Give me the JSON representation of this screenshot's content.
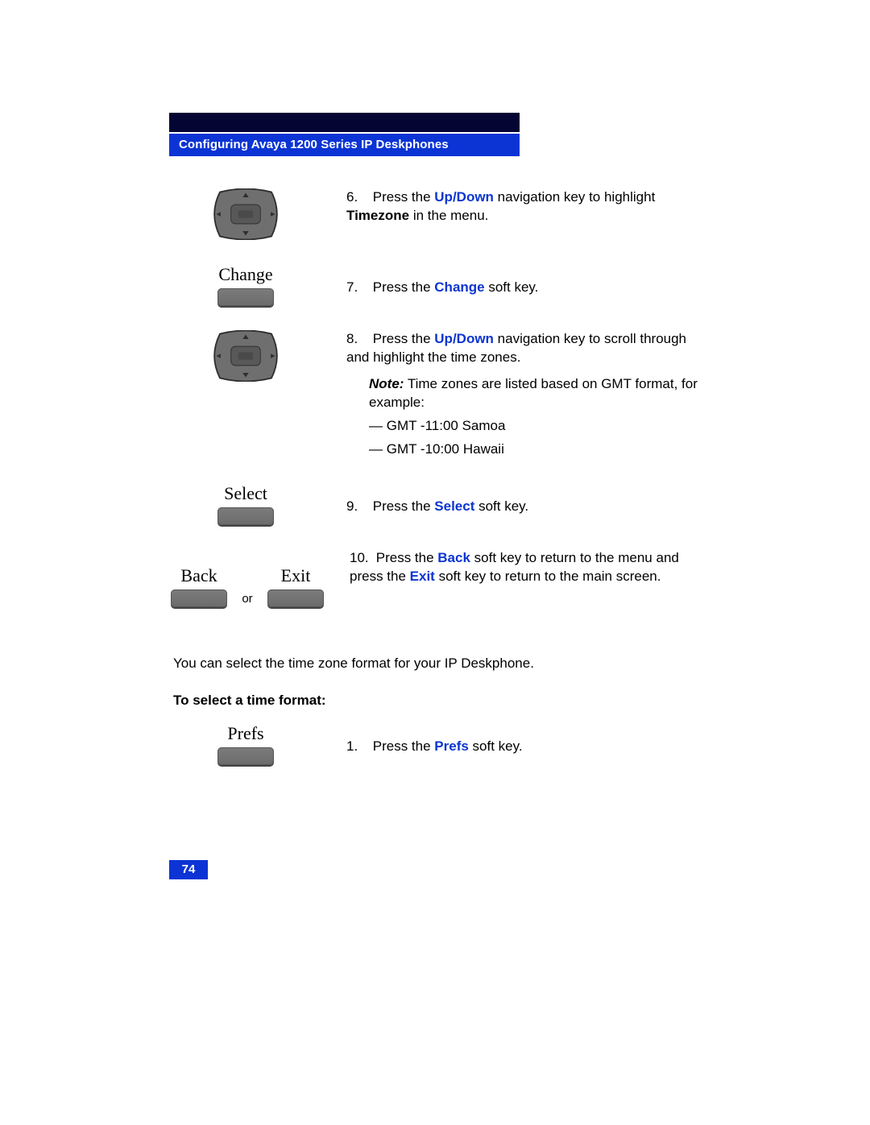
{
  "header": {
    "title": "Configuring Avaya 1200 Series IP Deskphones"
  },
  "page_number": "74",
  "steps": {
    "s6": {
      "num": "6.",
      "pre": "Press the ",
      "kw1": "Up/Down",
      "mid": " navigation key to highlight ",
      "kw2": "Timezone",
      "post": " in the menu."
    },
    "s7": {
      "softkey_label": "Change",
      "num": "7.",
      "pre": "Press the ",
      "kw": "Change",
      "post": " soft key."
    },
    "s8": {
      "num": "8.",
      "pre": "Press the ",
      "kw": "Up/Down",
      "post": " navigation key to scroll through and highlight the time zones.",
      "note_label": "Note:",
      "note_text": "  Time zones are listed based on GMT format, for example:",
      "dash1": "GMT -11:00 Samoa",
      "dash2": "GMT -10:00 Hawaii"
    },
    "s9": {
      "softkey_label": "Select",
      "num": "9.",
      "pre": "Press the ",
      "kw": "Select",
      "post": " soft key."
    },
    "s10": {
      "back_label": "Back",
      "exit_label": "Exit",
      "or": "or",
      "num": "10.",
      "pre": "Press the ",
      "kw1": "Back",
      "mid": " soft key to return to the menu and press the ",
      "kw2": "Exit",
      "post": " soft key to return to the main screen."
    }
  },
  "section2": {
    "intro": "You can select the time zone format for your IP Deskphone.",
    "heading": "To select a time format:",
    "step1": {
      "softkey_label": "Prefs",
      "num": "1.",
      "pre": "Press the ",
      "kw": "Prefs",
      "post": " soft key."
    }
  }
}
